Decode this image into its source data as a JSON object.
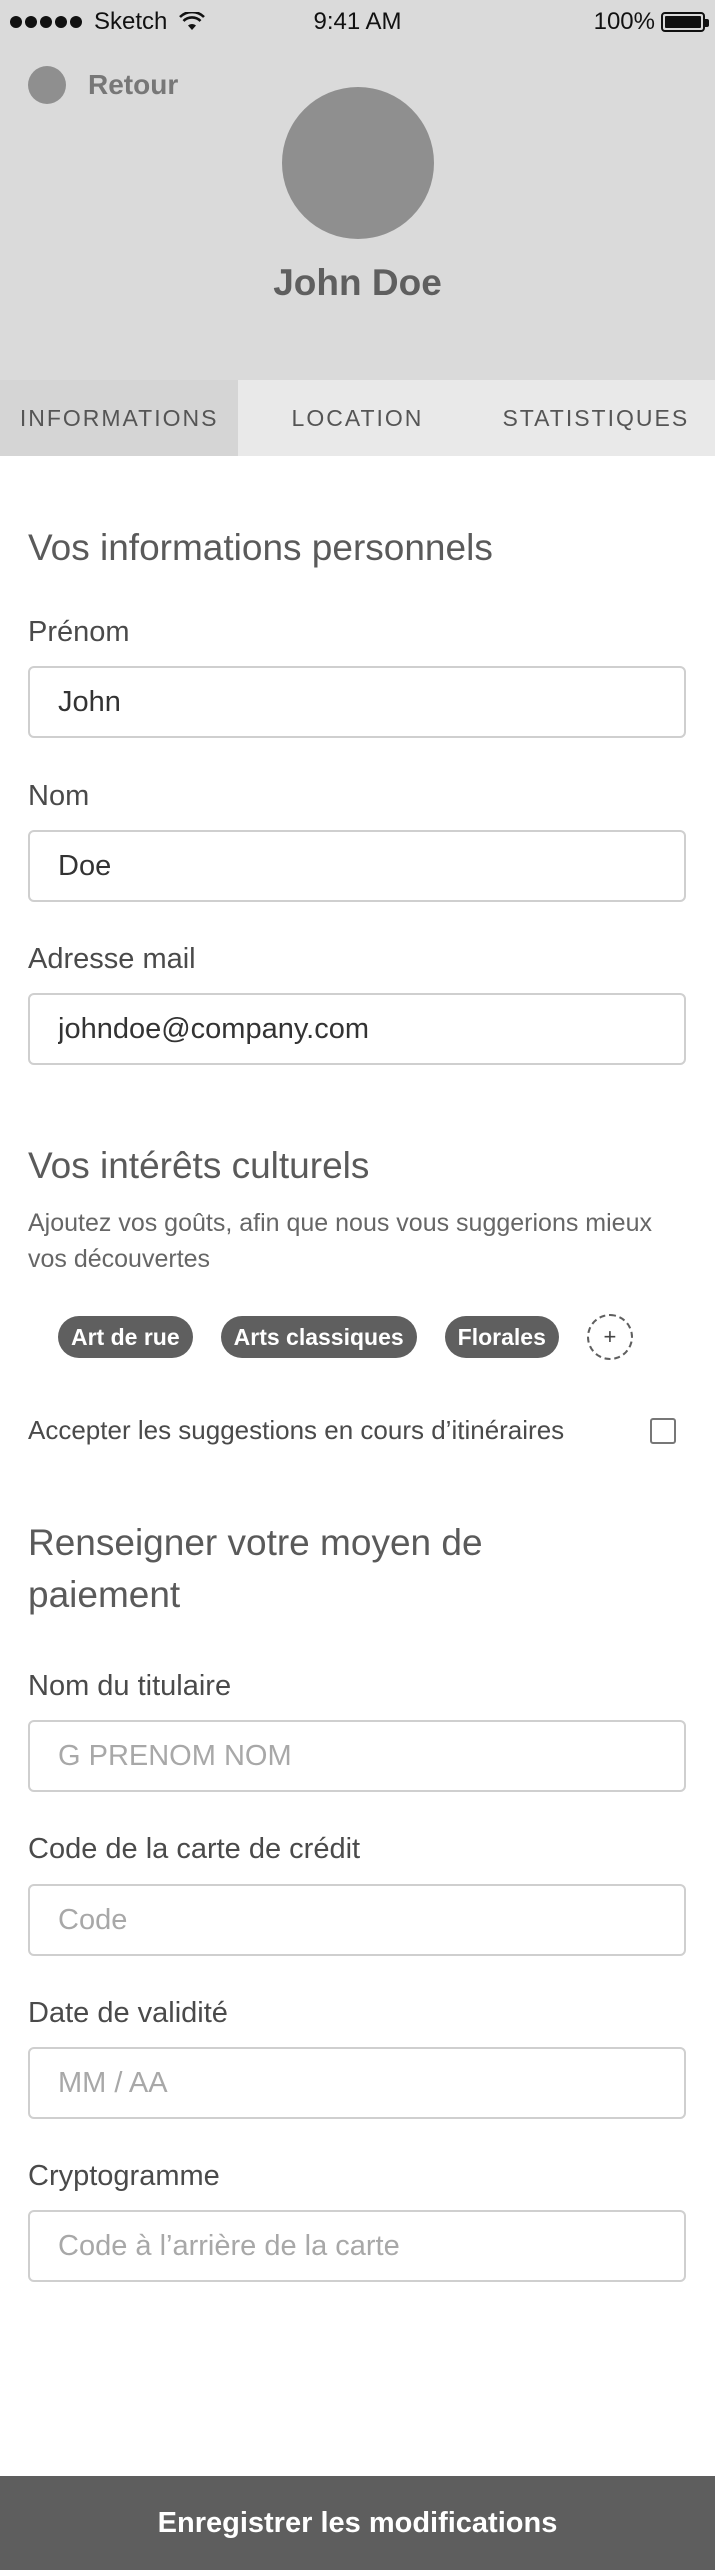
{
  "status_bar": {
    "carrier": "Sketch",
    "time": "9:41 AM",
    "battery": "100%"
  },
  "header": {
    "back_label": "Retour",
    "user_name": "John Doe"
  },
  "tabs": [
    {
      "label": "INFORMATIONS",
      "active": true
    },
    {
      "label": "LOCATION",
      "active": false
    },
    {
      "label": "STATISTIQUES",
      "active": false
    }
  ],
  "personal": {
    "title": "Vos informations personnels",
    "first_name": {
      "label": "Prénom",
      "value": "John"
    },
    "last_name": {
      "label": "Nom",
      "value": "Doe"
    },
    "email": {
      "label": "Adresse mail",
      "value": "johndoe@company.com"
    }
  },
  "interests": {
    "title": "Vos intérêts culturels",
    "help": "Ajoutez vos goûts, afin que nous vous suggerions mieux vos découvertes",
    "tags": [
      "Art de rue",
      "Arts classiques",
      "Florales"
    ],
    "add_symbol": "+",
    "accept_label": "Accepter les suggestions en cours d’itinéraires"
  },
  "payment": {
    "title_line1": "Renseigner votre moyen de",
    "title_line2": "paiement",
    "holder": {
      "label": "Nom du titulaire",
      "placeholder": "G PRENOM NOM"
    },
    "card_code": {
      "label": "Code de la carte de crédit",
      "placeholder": "Code"
    },
    "expiry": {
      "label": "Date de validité",
      "placeholder": "MM / AA"
    },
    "cvv": {
      "label": "Cryptogramme",
      "placeholder": "Code à l’arrière de la carte"
    }
  },
  "footer": {
    "save_label": "Enregistrer les modifications"
  },
  "colors": {
    "header_bg": "#dadada",
    "tab_bg": "#e9e9e9",
    "tab_active_bg": "#d5d5d5",
    "tag_bg": "#5f5f5f",
    "footer_bg": "#5e5e5e"
  }
}
